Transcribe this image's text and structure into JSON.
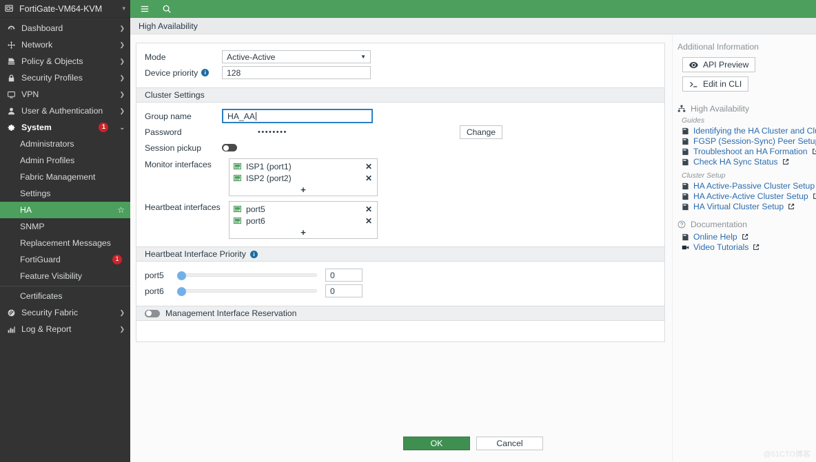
{
  "colors": {
    "brand_green": "#4c9f5c",
    "sidebar_bg": "#333333",
    "accent_blue": "#2b6cb0",
    "badge_red": "#cc2229",
    "ok_green": "#3f8f51",
    "slider_blue": "#74b0e8"
  },
  "sidebar": {
    "brand": {
      "name": "FortiGate-VM64-KVM",
      "icon": "device-icon",
      "caret": "▾"
    },
    "items": [
      {
        "label": "Dashboard",
        "icon": "dashboard-icon",
        "chevron": "❯",
        "badge": null
      },
      {
        "label": "Network",
        "icon": "network-icon",
        "chevron": "❯",
        "badge": null
      },
      {
        "label": "Policy & Objects",
        "icon": "policy-icon",
        "chevron": "❯",
        "badge": null
      },
      {
        "label": "Security Profiles",
        "icon": "lock-icon",
        "chevron": "❯",
        "badge": null
      },
      {
        "label": "VPN",
        "icon": "monitor-icon",
        "chevron": "❯",
        "badge": null
      },
      {
        "label": "User & Authentication",
        "icon": "user-icon",
        "chevron": "❯",
        "badge": null
      },
      {
        "label": "System",
        "icon": "gear-icon",
        "chevron": "⌄",
        "badge": "1",
        "active": true
      }
    ],
    "subitems": [
      {
        "label": "Administrators",
        "selected": false
      },
      {
        "label": "Admin Profiles",
        "selected": false
      },
      {
        "label": "Fabric Management",
        "selected": false
      },
      {
        "label": "Settings",
        "selected": false
      },
      {
        "label": "HA",
        "selected": true,
        "star": "☆"
      },
      {
        "label": "SNMP",
        "selected": false
      },
      {
        "label": "Replacement Messages",
        "selected": false
      },
      {
        "label": "FortiGuard",
        "selected": false,
        "badge": "1"
      },
      {
        "label": "Feature Visibility",
        "selected": false
      }
    ],
    "bottom_items": [
      {
        "label": "Certificates",
        "icon": null,
        "chevron": null
      },
      {
        "label": "Security Fabric",
        "icon": "fabric-icon",
        "chevron": "❯"
      },
      {
        "label": "Log & Report",
        "icon": "chart-icon",
        "chevron": "❯"
      }
    ]
  },
  "topbar": {
    "menu_icon": "hamburger-icon",
    "search_icon": "search-icon"
  },
  "page": {
    "title": "High Availability"
  },
  "form": {
    "mode": {
      "label": "Mode",
      "value": "Active-Active"
    },
    "device_priority": {
      "label": "Device priority",
      "value": "128",
      "info": "info-icon"
    },
    "cluster_settings_header": "Cluster Settings",
    "group_name": {
      "label": "Group name",
      "value": "HA_AA"
    },
    "password": {
      "label": "Password",
      "value": "••••••••",
      "button": "Change"
    },
    "session_pickup": {
      "label": "Session pickup",
      "state": "off"
    },
    "monitor_interfaces": {
      "label": "Monitor interfaces",
      "items": [
        {
          "name": "ISP1 (port1)",
          "icon": "interface-icon",
          "remove": "✕"
        },
        {
          "name": "ISP2 (port2)",
          "icon": "interface-icon",
          "remove": "✕"
        }
      ],
      "add": "+"
    },
    "heartbeat_interfaces": {
      "label": "Heartbeat interfaces",
      "items": [
        {
          "name": "port5",
          "icon": "interface-icon",
          "remove": "✕"
        },
        {
          "name": "port6",
          "icon": "interface-icon",
          "remove": "✕"
        }
      ],
      "add": "+"
    },
    "heartbeat_priority": {
      "header": "Heartbeat Interface Priority",
      "info": "info-icon",
      "rows": [
        {
          "label": "port5",
          "value": "0"
        },
        {
          "label": "port6",
          "value": "0"
        }
      ]
    },
    "management_interface_reservation": {
      "label": "Management Interface Reservation",
      "state": "off"
    }
  },
  "additional_info": {
    "title": "Additional Information",
    "buttons": [
      {
        "label": "API Preview",
        "icon": "eye-icon"
      },
      {
        "label": "Edit in CLI",
        "icon": "cli-icon"
      }
    ],
    "sections": [
      {
        "title": "High Availability",
        "icon": "sitemap-icon",
        "groups": [
          {
            "subtitle": "Guides",
            "links": [
              {
                "label": "Identifying the HA Cluster and Clu",
                "icon": "book-icon",
                "external": true
              },
              {
                "label": "FGSP (Session-Sync) Peer Setup",
                "icon": "book-icon",
                "external": true
              },
              {
                "label": "Troubleshoot an HA Formation",
                "icon": "book-icon",
                "external": true
              },
              {
                "label": "Check HA Sync Status",
                "icon": "book-icon",
                "external": true
              }
            ]
          },
          {
            "subtitle": "Cluster Setup",
            "links": [
              {
                "label": "HA Active-Passive Cluster Setup",
                "icon": "book-icon",
                "external": true
              },
              {
                "label": "HA Active-Active Cluster Setup",
                "icon": "book-icon",
                "external": true
              },
              {
                "label": "HA Virtual Cluster Setup",
                "icon": "book-icon",
                "external": true
              }
            ]
          }
        ]
      },
      {
        "title": "Documentation",
        "icon": "question-icon",
        "groups": [
          {
            "subtitle": null,
            "links": [
              {
                "label": "Online Help",
                "icon": "book-icon",
                "external": true
              },
              {
                "label": "Video Tutorials",
                "icon": "video-icon",
                "external": true
              }
            ]
          }
        ]
      }
    ]
  },
  "footer": {
    "ok": "OK",
    "cancel": "Cancel"
  },
  "watermark": "@51CTO博客"
}
